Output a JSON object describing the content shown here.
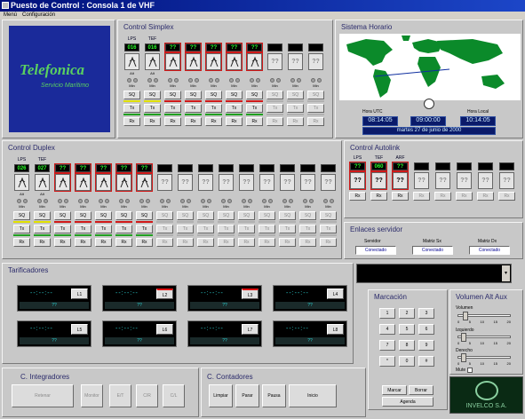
{
  "window": {
    "title": "Puesto de Control : Consola 1 de VHF"
  },
  "menu": [
    "Menú",
    "Configuración"
  ],
  "logo": {
    "brand": "Telefonica",
    "sub": "Servicio Marítimo"
  },
  "simplex": {
    "title": "Control Simplex",
    "columns": [
      {
        "hdr": "LPS",
        "chan": "016",
        "type": "active",
        "lbl": "Alt"
      },
      {
        "hdr": "TEF",
        "chan": "016",
        "type": "active",
        "lbl": "Alt"
      },
      {
        "hdr": "",
        "chan": "??",
        "type": "red",
        "lbl": ""
      },
      {
        "hdr": "",
        "chan": "??",
        "type": "red",
        "lbl": ""
      },
      {
        "hdr": "",
        "chan": "??",
        "type": "red",
        "lbl": ""
      },
      {
        "hdr": "",
        "chan": "??",
        "type": "red",
        "lbl": ""
      },
      {
        "hdr": "",
        "chan": "??",
        "type": "red",
        "lbl": ""
      },
      {
        "hdr": "",
        "chan": "",
        "type": "dis",
        "lbl": ""
      },
      {
        "hdr": "",
        "chan": "",
        "type": "dis",
        "lbl": ""
      },
      {
        "hdr": "",
        "chan": "",
        "type": "dis",
        "lbl": ""
      }
    ],
    "min": "Min",
    "sq": "SQ",
    "tx": "Tx",
    "rx": "Rx",
    "q": "??"
  },
  "horario": {
    "title": "Sistema Horario",
    "utc_label": "Hora UTC",
    "utc": "08:14:05",
    "center": "09:00:00",
    "local_label": "Hora Local",
    "local": "10:14:05",
    "date": "martes 27 de junio de 2000"
  },
  "duplex": {
    "title": "Control Duplex",
    "columns": [
      {
        "hdr": "LPS",
        "chan": "026",
        "type": "active",
        "lbl": "Alt"
      },
      {
        "hdr": "TEF",
        "chan": "027",
        "type": "active",
        "lbl": "Alt"
      },
      {
        "hdr": "",
        "chan": "??",
        "type": "red"
      },
      {
        "hdr": "",
        "chan": "??",
        "type": "red"
      },
      {
        "hdr": "",
        "chan": "??",
        "type": "red"
      },
      {
        "hdr": "",
        "chan": "??",
        "type": "red"
      },
      {
        "hdr": "",
        "chan": "??",
        "type": "red"
      },
      {
        "hdr": "",
        "chan": "",
        "type": "dis"
      },
      {
        "hdr": "",
        "chan": "",
        "type": "dis"
      },
      {
        "hdr": "",
        "chan": "",
        "type": "dis"
      },
      {
        "hdr": "",
        "chan": "",
        "type": "dis"
      },
      {
        "hdr": "",
        "chan": "",
        "type": "dis"
      },
      {
        "hdr": "",
        "chan": "",
        "type": "dis"
      },
      {
        "hdr": "",
        "chan": "",
        "type": "dis"
      },
      {
        "hdr": "",
        "chan": "",
        "type": "dis"
      },
      {
        "hdr": "",
        "chan": "",
        "type": "dis"
      }
    ]
  },
  "autolink": {
    "title": "Control Autolink",
    "columns": [
      {
        "hdr": "LPS",
        "chan": "??",
        "type": "red"
      },
      {
        "hdr": "TEF",
        "chan": "060",
        "type": "red"
      },
      {
        "hdr": "ARF",
        "chan": "??",
        "type": "red"
      },
      {
        "hdr": "",
        "chan": "",
        "type": "dis"
      },
      {
        "hdr": "",
        "chan": "",
        "type": "dis"
      },
      {
        "hdr": "",
        "chan": "",
        "type": "dis"
      },
      {
        "hdr": "",
        "chan": "",
        "type": "dis"
      },
      {
        "hdr": "",
        "chan": "",
        "type": "dis"
      }
    ]
  },
  "enlaces": {
    "title": "Enlaces servidor",
    "items": [
      {
        "label": "Servidor",
        "value": "Conectado"
      },
      {
        "label": "Matriz Sx",
        "value": "Conectado"
      },
      {
        "label": "Matriz Dx",
        "value": "Conectado"
      }
    ]
  },
  "tarificadores": {
    "title": "Tarificadores",
    "time": "--:--:--",
    "items": [
      {
        "label": "L1",
        "bar": "??"
      },
      {
        "label": "L2",
        "bar": "??"
      },
      {
        "label": "L3",
        "bar": "??"
      },
      {
        "label": "L4",
        "bar": "??"
      },
      {
        "label": "L5",
        "bar": "??"
      },
      {
        "label": "L6",
        "bar": "??"
      },
      {
        "label": "L7",
        "bar": "??"
      },
      {
        "label": "L8",
        "bar": "??"
      }
    ]
  },
  "marcacion": {
    "title": "Marcación",
    "keys": [
      "1",
      "2",
      "3",
      "4",
      "5",
      "6",
      "7",
      "8",
      "9",
      "*",
      "0",
      "#"
    ],
    "marcar": "Marcar",
    "borrar": "Borrar",
    "agenda": "Agenda"
  },
  "volumen": {
    "title": "Volumen Alt Aux",
    "sliders": [
      {
        "label": "Volumen",
        "level": 0.1
      },
      {
        "label": "Izquierdo",
        "level": 0.05
      },
      {
        "label": "Derecho",
        "level": 0.05
      }
    ],
    "ticks": [
      "0",
      "5",
      "10",
      "15",
      "20"
    ],
    "mute": "Mute"
  },
  "integradores": {
    "title": "C. Integradores",
    "buttons": [
      "Retenar",
      "Monitor",
      "E/T",
      "C/R",
      "C/L"
    ]
  },
  "contadores": {
    "title": "C. Contadores",
    "buttons": [
      "Limpiar",
      "Parar",
      "Pausa",
      "Inicio"
    ]
  },
  "invelco": {
    "brand": "INVELCO S.A."
  },
  "colors": {
    "title": "#00107a",
    "red": "#d01818",
    "map": "#0b8a2a",
    "ocean": "#ffffff"
  }
}
